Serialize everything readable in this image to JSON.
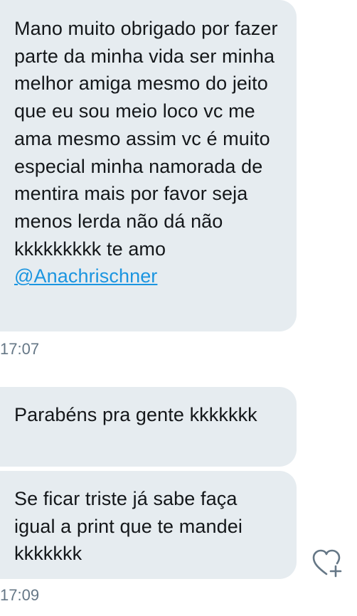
{
  "messages": [
    {
      "text": "Mano muito obrigado por fazer parte da minha vida ser minha melhor amiga mesmo do jeito que eu sou meio loco vc me ama mesmo assim vc é muito especial minha namorada de mentira mais por favor seja menos lerda não dá não kkkkkkkkk te amo",
      "mention": "@Anachrischner"
    },
    {
      "text": "Parabéns pra gente kkkkkkk"
    },
    {
      "text": "Se ficar triste já sabe faça igual a print que te mandei kkkkkkk"
    }
  ],
  "timestamps": [
    "17:07",
    "17:09"
  ],
  "like_icon": "heart-plus-icon",
  "colors": {
    "bubble": "#e6ecf0",
    "text": "#14171a",
    "mention": "#1b95e0",
    "timestamp": "#657786"
  }
}
